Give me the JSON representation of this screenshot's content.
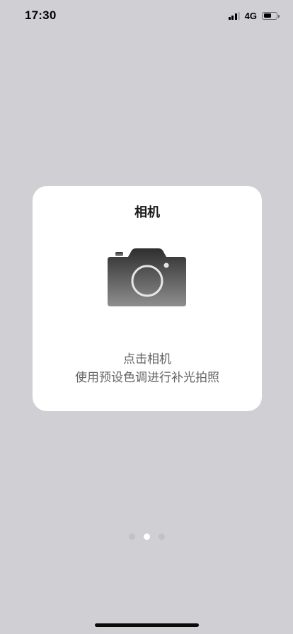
{
  "status_bar": {
    "time": "17:30",
    "network": "4G",
    "battery_level": 0.6,
    "signal_bars": 3
  },
  "card": {
    "title": "相机",
    "icon": "camera-icon",
    "description_line1": "点击相机",
    "description_line2": "使用预设色调进行补光拍照"
  },
  "pager": {
    "count": 3,
    "active_index": 1
  },
  "colors": {
    "background": "#d0cfd4",
    "card": "#ffffff",
    "dot_active": "#ffffff",
    "dot_inactive": "#c2c2c6"
  }
}
